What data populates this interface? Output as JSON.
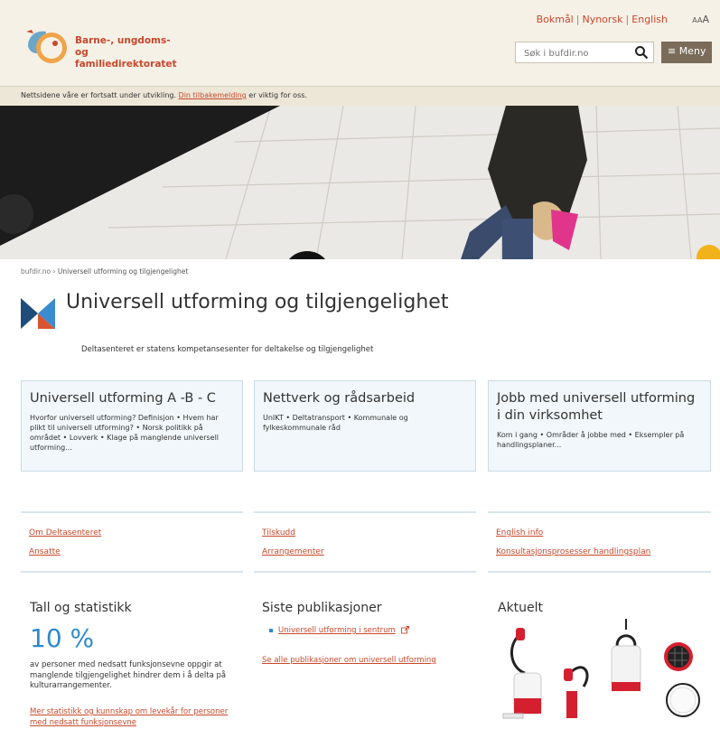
{
  "header": {
    "logo_line1": "Barne-, ungdoms-",
    "logo_line2": "og familiedirektoratet",
    "languages": [
      "Bokmål",
      "Nynorsk",
      "English"
    ],
    "font_size_small": "A",
    "font_size_large": "A",
    "search_placeholder": "Søk i bufdir.no",
    "menu_label": "≡ Meny"
  },
  "notice": {
    "text_before": "Nettsidene våre er fortsatt under utvikling. ",
    "link": "Din tilbakemelding",
    "text_after": " er viktig for oss."
  },
  "breadcrumb": {
    "home": "bufdir.no",
    "separator": "›",
    "current": "Universell utforming og tilgjengelighet"
  },
  "page": {
    "title": "Universell utforming og tilgjengelighet",
    "subtitle": "Deltasenteret er statens kompetansesenter for deltakelse og tilgjengelighet"
  },
  "cards": [
    {
      "title": "Universell utforming A -B - C",
      "desc": "Hvorfor universell utforming? Definisjon • Hvem har plikt til universell utforming? • Norsk politikk på området • Lovverk • Klage på manglende universell utforming..."
    },
    {
      "title": "Nettverk og rådsarbeid",
      "desc": "UnIKT • Deltatransport • Kommunale og fylkeskommunale råd"
    },
    {
      "title": "Jobb med universell utforming i din virksomhet",
      "desc": "Kom i gang • Områder å jobbe med • Eksempler på handlingsplaner..."
    }
  ],
  "links": [
    [
      "Om Deltasenteret",
      "Ansatte"
    ],
    [
      "Tilskudd",
      "Arrangementer"
    ],
    [
      "English info",
      "Konsultasjonsprosesser handlingsplan"
    ]
  ],
  "stats": {
    "title": "Tall og statistikk",
    "value": "10 %",
    "desc": "av personer med nedsatt funksjonsevne oppgir at manglende tilgjengelighet hindrer dem i å delta på kulturarrangementer.",
    "link": "Mer statistikk og kunnskap om levekår for personer med nedsatt funksjonsevne"
  },
  "publications": {
    "title": "Siste publikasjoner",
    "item": "Universell utforming i sentrum",
    "all_link": "Se alle publikasjoner om universell utforming"
  },
  "news": {
    "title": "Aktuelt"
  },
  "colors": {
    "accent": "#c8482c",
    "blue": "#2e8bc9",
    "header_bg": "#f6f1e7",
    "card_bg": "#f1f7fb"
  }
}
